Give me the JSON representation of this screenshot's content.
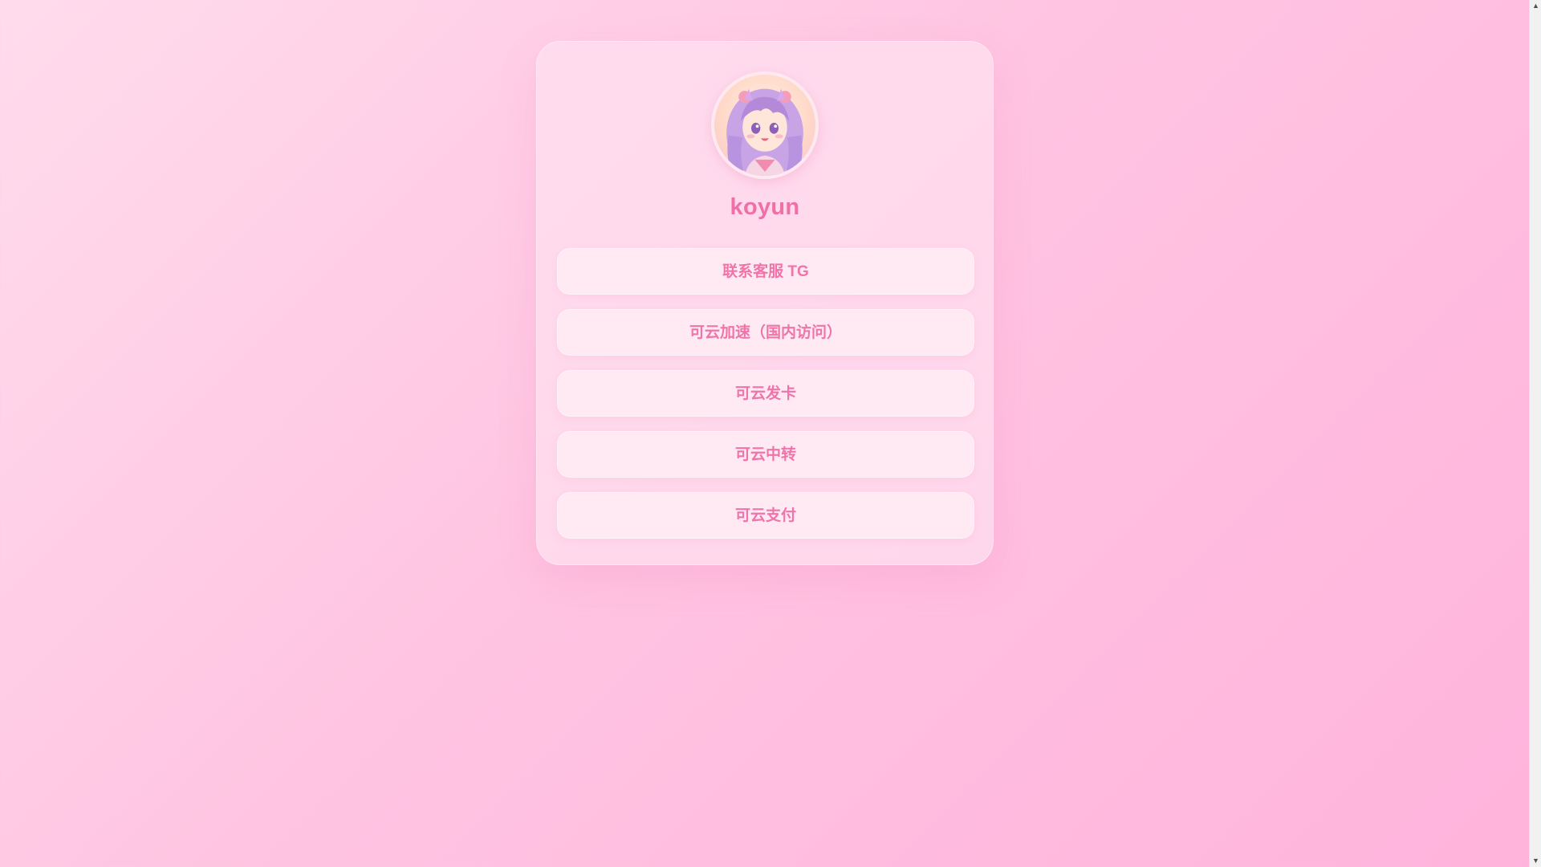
{
  "profile": {
    "username": "koyun"
  },
  "links": [
    {
      "label": "联系客服 TG"
    },
    {
      "label": "可云加速（国内访问）"
    },
    {
      "label": "可云发卡"
    },
    {
      "label": "可云中转"
    },
    {
      "label": "可云支付"
    }
  ],
  "icons": {
    "avatar": "anime-girl-avatar",
    "scroll_up": "chevron-up-icon",
    "scroll_down": "chevron-down-icon"
  },
  "colors": {
    "accent": "#ef6fa6",
    "background_start": "#ffdcec",
    "background_end": "#ffb3dc"
  }
}
